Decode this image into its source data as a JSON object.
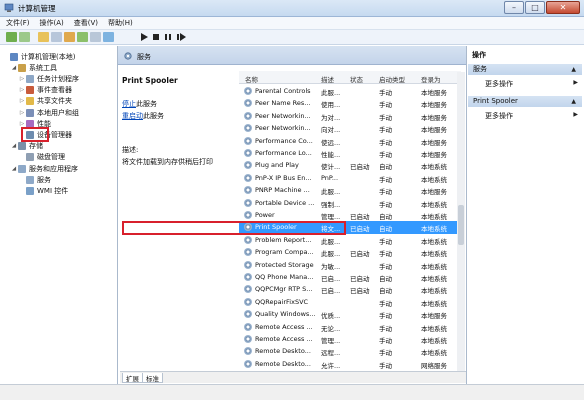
{
  "window": {
    "title": "计算机管理"
  },
  "menu": [
    "文件(F)",
    "操作(A)",
    "查看(V)",
    "帮助(H)"
  ],
  "tree": [
    {
      "label": "计算机管理(本地)",
      "level": 0,
      "exp": ""
    },
    {
      "label": "系统工具",
      "level": 1,
      "exp": "◢"
    },
    {
      "label": "任务计划程序",
      "level": 2,
      "exp": "▷"
    },
    {
      "label": "事件查看器",
      "level": 2,
      "exp": "▷"
    },
    {
      "label": "共享文件夹",
      "level": 2,
      "exp": "▷"
    },
    {
      "label": "本地用户和组",
      "level": 2,
      "exp": "▷"
    },
    {
      "label": "性能",
      "level": 2,
      "exp": "▷"
    },
    {
      "label": "设备管理器",
      "level": 2,
      "exp": ""
    },
    {
      "label": "存储",
      "level": 1,
      "exp": "◢"
    },
    {
      "label": "磁盘管理",
      "level": 2,
      "exp": ""
    },
    {
      "label": "服务和应用程序",
      "level": 1,
      "exp": "◢"
    },
    {
      "label": "服务",
      "level": 2,
      "exp": ""
    },
    {
      "label": "WMI 控件",
      "level": 2,
      "exp": ""
    }
  ],
  "center": {
    "header": "服务",
    "service_name": "Print Spooler",
    "stop_link": "停止",
    "stop_rest": "此服务",
    "restart_link": "重启动",
    "restart_rest": "此服务",
    "desc_label": "描述:",
    "desc_text": "将文件加载到内存供稍后打印"
  },
  "grid": {
    "columns": [
      "名称",
      "描述",
      "状态",
      "启动类型",
      "登录为"
    ],
    "rows": [
      [
        "Parental Controls",
        "此服...",
        "",
        "手动",
        "本地服务"
      ],
      [
        "Peer Name Res...",
        "使用...",
        "",
        "手动",
        "本地服务"
      ],
      [
        "Peer Networkin...",
        "为对...",
        "",
        "手动",
        "本地服务"
      ],
      [
        "Peer Networkin...",
        "向对...",
        "",
        "手动",
        "本地服务"
      ],
      [
        "Performance Co...",
        "使远...",
        "",
        "手动",
        "本地服务"
      ],
      [
        "Performance Lo...",
        "性能...",
        "",
        "手动",
        "本地服务"
      ],
      [
        "Plug and Play",
        "使计...",
        "已启动",
        "自动",
        "本地系统"
      ],
      [
        "PnP-X IP Bus En...",
        "PnP...",
        "",
        "手动",
        "本地系统"
      ],
      [
        "PNRP Machine ...",
        "此服...",
        "",
        "手动",
        "本地服务"
      ],
      [
        "Portable Device ...",
        "强制...",
        "",
        "手动",
        "本地系统"
      ],
      [
        "Power",
        "管理...",
        "已启动",
        "自动",
        "本地系统"
      ],
      [
        "Print Spooler",
        "将文...",
        "已启动",
        "自动",
        "本地系统"
      ],
      [
        "Problem Report...",
        "此服...",
        "",
        "手动",
        "本地系统"
      ],
      [
        "Program Compa...",
        "此服...",
        "已启动",
        "手动",
        "本地系统"
      ],
      [
        "Protected Storage",
        "为敏...",
        "",
        "手动",
        "本地系统"
      ],
      [
        "QQ Phone Mana...",
        "已启...",
        "已启动",
        "自动",
        "本地系统"
      ],
      [
        "QQPCMgr RTP S...",
        "已启...",
        "已启动",
        "自动",
        "本地系统"
      ],
      [
        "QQRepairFixSVC",
        "",
        "",
        "手动",
        "本地系统"
      ],
      [
        "Quality Windows...",
        "优质...",
        "",
        "手动",
        "本地服务"
      ],
      [
        "Remote Access ...",
        "无论...",
        "",
        "手动",
        "本地系统"
      ],
      [
        "Remote Access ...",
        "管理...",
        "",
        "手动",
        "本地系统"
      ],
      [
        "Remote Deskto...",
        "远程...",
        "",
        "手动",
        "本地系统"
      ],
      [
        "Remote Deskto...",
        "允许...",
        "",
        "手动",
        "网络服务"
      ]
    ],
    "selected_index": 11
  },
  "tabs": [
    "扩展",
    "标准"
  ],
  "actions": {
    "title": "操作",
    "sections": [
      {
        "label": "服务",
        "item": "更多操作"
      },
      {
        "label": "Print Spooler",
        "item": "更多操作"
      }
    ]
  },
  "colors": {
    "selection": "#3399ff",
    "highlight_box": "#d8202c",
    "link": "#0045b8"
  }
}
